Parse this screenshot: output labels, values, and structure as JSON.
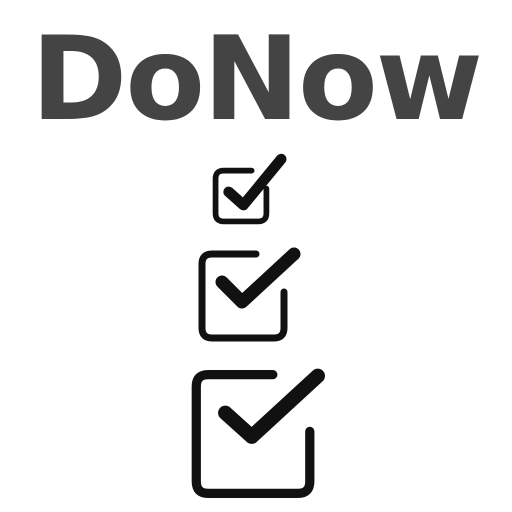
{
  "logo": {
    "text": "DoNow",
    "text_color": "#444444"
  },
  "icons": [
    {
      "name": "checkbox-checked-icon",
      "size": "small"
    },
    {
      "name": "checkbox-checked-icon",
      "size": "medium"
    },
    {
      "name": "checkbox-checked-icon",
      "size": "large"
    }
  ],
  "colors": {
    "background": "#ffffff",
    "icon": "#111111"
  }
}
